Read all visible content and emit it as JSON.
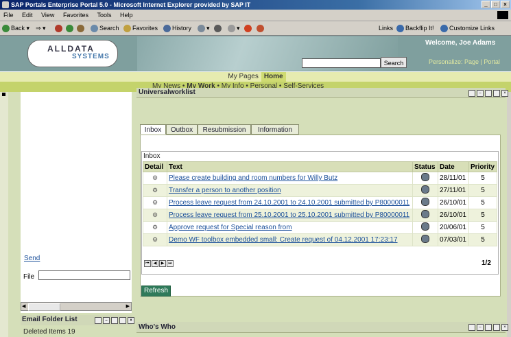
{
  "window": {
    "title": "SAP Portals Enterprise Portal 5.0 - Microsoft Internet Explorer provided by SAP IT"
  },
  "menu": [
    "File",
    "Edit",
    "View",
    "Favorites",
    "Tools",
    "Help"
  ],
  "toolbar": {
    "back": "Back",
    "search": "Search",
    "favorites": "Favorites",
    "history": "History",
    "links": "Links",
    "backflip": "Backflip It!",
    "customize": "Customize Links"
  },
  "header": {
    "logo_line1": "ALLDATA",
    "logo_line2": "SYSTEMS",
    "search_button": "Search",
    "welcome": "Welcome, Joe Adams",
    "personalize": "Personalize: Page | Portal"
  },
  "top_nav": {
    "items": [
      "My Pages",
      "Home"
    ],
    "active": "Home"
  },
  "sub_nav": {
    "items": [
      "My News",
      "My Work",
      "My Info",
      "Personal",
      "Self-Services"
    ],
    "separator": "•",
    "active": "My Work"
  },
  "left_panel": {
    "send_link": "Send",
    "file_label": "File"
  },
  "email_folder": {
    "title": "Email Folder List",
    "item": "Deleted Items 19"
  },
  "worklist": {
    "title": "Universalworklist",
    "tabs": [
      "Inbox",
      "Outbox",
      "Resubmission",
      "Information"
    ],
    "active_tab": "Inbox",
    "section_label": "Inbox",
    "columns": [
      "Detail",
      "Text",
      "Status",
      "Date",
      "Priority"
    ],
    "rows": [
      {
        "text": "Please create building and room numbers for Willy Butz",
        "date": "28/11/01",
        "priority": "5"
      },
      {
        "text": "Transfer a person to another position",
        "date": "27/11/01",
        "priority": "5"
      },
      {
        "text": "Process leave request from 24.10.2001 to 24.10.2001 submitted by P80000011",
        "date": "26/10/01",
        "priority": "5"
      },
      {
        "text": "Process leave request from 25.10.2001 to 25.10.2001 submitted by P80000011",
        "date": "26/10/01",
        "priority": "5"
      },
      {
        "text": "Approve request for Special reason from",
        "date": "20/06/01",
        "priority": "5"
      },
      {
        "text": "Demo WF toolbox embedded small: Create request of 04.12.2001 17:23:17",
        "date": "07/03/01",
        "priority": "5"
      }
    ],
    "page_indicator": "1/2",
    "refresh_button": "Refresh"
  },
  "whos_who": {
    "title": "Who's Who"
  },
  "colors": {
    "header_bg": "#7f9f9e",
    "nav_bg": "#e6ebb0",
    "subnav_bg": "#c4d36b",
    "canvas_bg": "#d5dfb9",
    "refresh_bg": "#2f7a5a",
    "link": "#1a4f9a"
  }
}
